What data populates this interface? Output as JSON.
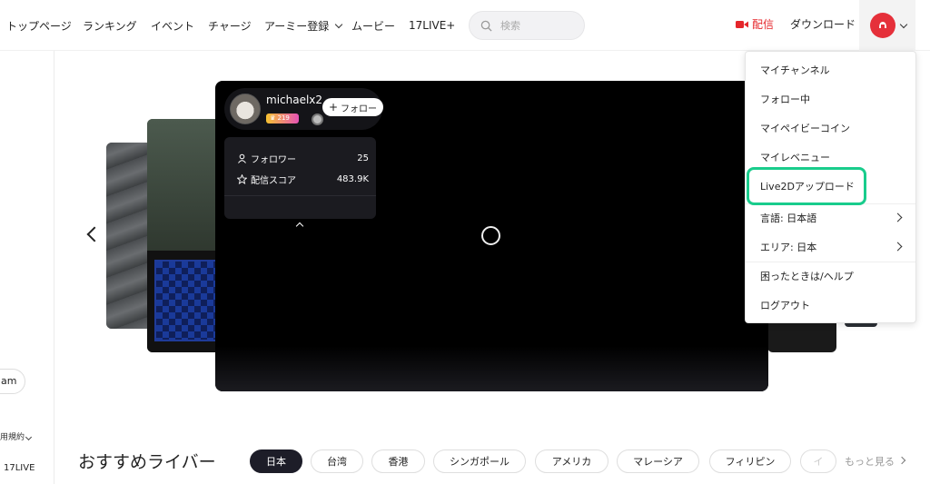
{
  "header": {
    "nav": {
      "top": "トップページ",
      "ranking": "ランキング",
      "event": "イベント",
      "charge": "チャージ",
      "army": "アーミー登録",
      "movie": "ムービー",
      "plus": "17LIVE+"
    },
    "search_placeholder": "検索",
    "live_label": "配信",
    "download_label": "ダウンロード"
  },
  "sidebar": {
    "pill": "am",
    "terms": "用規約",
    "brand": "17LIVE"
  },
  "streamer": {
    "name": "michaelx2",
    "level": "219",
    "follow_label": "フォロー",
    "stats": [
      {
        "label": "フォロワー",
        "value": "25"
      },
      {
        "label": "配信スコア",
        "value": "483.9K"
      }
    ]
  },
  "menu": {
    "items": [
      {
        "label": "マイチャンネル"
      },
      {
        "label": "フォロー中"
      },
      {
        "label": "マイペイビーコイン"
      },
      {
        "label": "マイレベニュー"
      },
      {
        "label": "Live2Dアップロード"
      },
      {
        "label": "言語:  日本語"
      },
      {
        "label": "エリア: 日本"
      },
      {
        "label": "困ったときは/ヘルプ"
      },
      {
        "label": "ログアウト"
      }
    ]
  },
  "recommend": {
    "title": "おすすめライバー",
    "chips": [
      "日本",
      "台湾",
      "香港",
      "シンガポール",
      "アメリカ",
      "マレーシア",
      "フィリピン",
      "イ"
    ],
    "more": "もっと見る"
  },
  "colors": {
    "live_red": "#e5262b",
    "highlight_green": "#19cc8c",
    "active_chip": "#1d1d28"
  }
}
